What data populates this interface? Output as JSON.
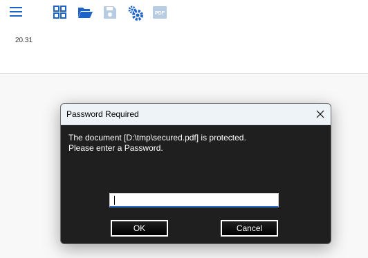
{
  "zoom": {
    "value": "20.31"
  },
  "toolbar": {
    "icons": [
      "hamburger-menu-icon",
      "grid-icon",
      "folder-open-icon",
      "save-icon",
      "settings-gears-icon",
      "pdf-icon"
    ],
    "pdf_label": "PDF",
    "accent_color": "#1e64c8",
    "disabled_color": "#b7cbe3"
  },
  "dialog": {
    "title": "Password Required",
    "message_line1": "The document [D:\\tmp\\secured.pdf] is protected.",
    "message_line2": "Please enter a Password.",
    "password_value": "",
    "ok_label": "OK",
    "cancel_label": "Cancel"
  }
}
